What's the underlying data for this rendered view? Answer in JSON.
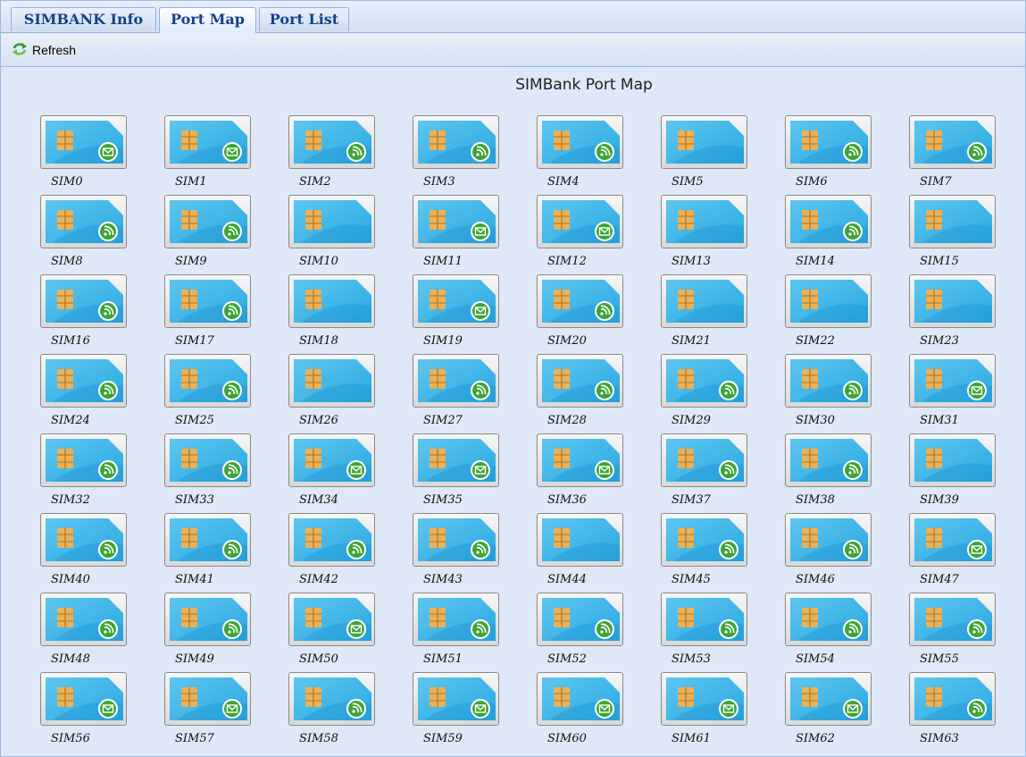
{
  "tabs": [
    {
      "label": "SIMBANK Info",
      "active": false
    },
    {
      "label": "Port Map",
      "active": true
    },
    {
      "label": "Port List",
      "active": false
    }
  ],
  "toolbar": {
    "refresh_label": "Refresh",
    "refresh_icon": "refresh-icon"
  },
  "title": "SIMBank Port Map",
  "status_icons": {
    "signal": "green circle with signal arcs",
    "message": "green circle with envelope",
    "none": "empty card"
  },
  "colors": {
    "card_blue": "#29a9e1",
    "chip_gold": "#e9b25a",
    "status_green": "#3fa436"
  },
  "sims": [
    {
      "label": "SIM0",
      "status": "message"
    },
    {
      "label": "SIM1",
      "status": "message"
    },
    {
      "label": "SIM2",
      "status": "signal"
    },
    {
      "label": "SIM3",
      "status": "signal"
    },
    {
      "label": "SIM4",
      "status": "signal"
    },
    {
      "label": "SIM5",
      "status": "none"
    },
    {
      "label": "SIM6",
      "status": "signal"
    },
    {
      "label": "SIM7",
      "status": "signal"
    },
    {
      "label": "SIM8",
      "status": "signal"
    },
    {
      "label": "SIM9",
      "status": "signal"
    },
    {
      "label": "SIM10",
      "status": "none"
    },
    {
      "label": "SIM11",
      "status": "message"
    },
    {
      "label": "SIM12",
      "status": "message"
    },
    {
      "label": "SIM13",
      "status": "none"
    },
    {
      "label": "SIM14",
      "status": "signal"
    },
    {
      "label": "SIM15",
      "status": "none"
    },
    {
      "label": "SIM16",
      "status": "signal"
    },
    {
      "label": "SIM17",
      "status": "signal"
    },
    {
      "label": "SIM18",
      "status": "none"
    },
    {
      "label": "SIM19",
      "status": "message"
    },
    {
      "label": "SIM20",
      "status": "signal"
    },
    {
      "label": "SIM21",
      "status": "none"
    },
    {
      "label": "SIM22",
      "status": "none"
    },
    {
      "label": "SIM23",
      "status": "none"
    },
    {
      "label": "SIM24",
      "status": "signal"
    },
    {
      "label": "SIM25",
      "status": "signal"
    },
    {
      "label": "SIM26",
      "status": "none"
    },
    {
      "label": "SIM27",
      "status": "signal"
    },
    {
      "label": "SIM28",
      "status": "signal"
    },
    {
      "label": "SIM29",
      "status": "signal"
    },
    {
      "label": "SIM30",
      "status": "signal"
    },
    {
      "label": "SIM31",
      "status": "message"
    },
    {
      "label": "SIM32",
      "status": "signal"
    },
    {
      "label": "SIM33",
      "status": "signal"
    },
    {
      "label": "SIM34",
      "status": "message"
    },
    {
      "label": "SIM35",
      "status": "message"
    },
    {
      "label": "SIM36",
      "status": "message"
    },
    {
      "label": "SIM37",
      "status": "signal"
    },
    {
      "label": "SIM38",
      "status": "signal"
    },
    {
      "label": "SIM39",
      "status": "none"
    },
    {
      "label": "SIM40",
      "status": "signal"
    },
    {
      "label": "SIM41",
      "status": "signal"
    },
    {
      "label": "SIM42",
      "status": "signal"
    },
    {
      "label": "SIM43",
      "status": "signal"
    },
    {
      "label": "SIM44",
      "status": "none"
    },
    {
      "label": "SIM45",
      "status": "signal"
    },
    {
      "label": "SIM46",
      "status": "signal"
    },
    {
      "label": "SIM47",
      "status": "message"
    },
    {
      "label": "SIM48",
      "status": "signal"
    },
    {
      "label": "SIM49",
      "status": "signal"
    },
    {
      "label": "SIM50",
      "status": "message"
    },
    {
      "label": "SIM51",
      "status": "signal"
    },
    {
      "label": "SIM52",
      "status": "signal"
    },
    {
      "label": "SIM53",
      "status": "signal"
    },
    {
      "label": "SIM54",
      "status": "signal"
    },
    {
      "label": "SIM55",
      "status": "signal"
    },
    {
      "label": "SIM56",
      "status": "message"
    },
    {
      "label": "SIM57",
      "status": "message"
    },
    {
      "label": "SIM58",
      "status": "signal"
    },
    {
      "label": "SIM59",
      "status": "message"
    },
    {
      "label": "SIM60",
      "status": "message"
    },
    {
      "label": "SIM61",
      "status": "message"
    },
    {
      "label": "SIM62",
      "status": "message"
    },
    {
      "label": "SIM63",
      "status": "signal"
    }
  ]
}
